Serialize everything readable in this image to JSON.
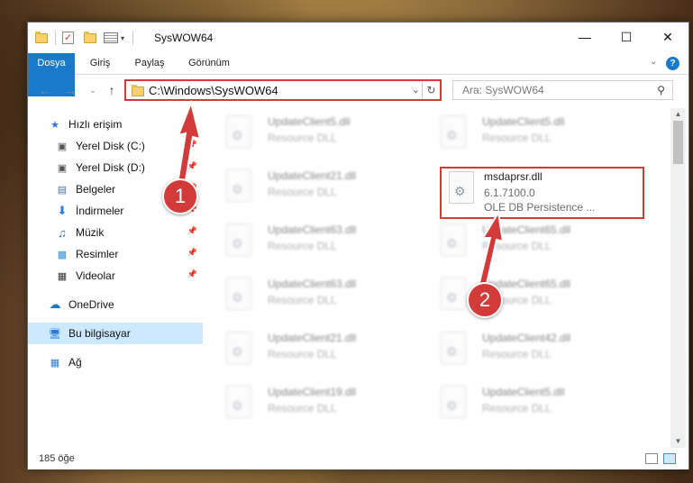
{
  "window": {
    "title": "SysWOW64",
    "minimize_icon": "minimize-icon",
    "maximize_icon": "maximize-icon",
    "close_icon": "close-icon"
  },
  "quick_access_toolbar": {
    "icons": [
      "folder-icon",
      "properties-check-icon",
      "new-folder-icon",
      "properties-icon",
      "customize-caret-icon"
    ]
  },
  "ribbon": {
    "tabs": [
      {
        "label": "Dosya",
        "active": true
      },
      {
        "label": "Giriş"
      },
      {
        "label": "Paylaş"
      },
      {
        "label": "Görünüm"
      }
    ],
    "help_label": "?"
  },
  "navigation": {
    "back_icon": "back-arrow-icon",
    "forward_icon": "forward-arrow-icon",
    "recent_icon": "chevron-down-icon",
    "up_icon": "up-arrow-icon",
    "address": "C:\\Windows\\SysWOW64",
    "search_placeholder": "Ara: SysWOW64"
  },
  "sidebar": {
    "items": [
      {
        "label": "Hızlı erişim",
        "icon": "star-icon"
      },
      {
        "label": "Yerel Disk (C:)",
        "icon": "drive-icon",
        "pinned": true
      },
      {
        "label": "Yerel Disk (D:)",
        "icon": "drive-icon",
        "pinned": true
      },
      {
        "label": "Belgeler",
        "icon": "documents-icon",
        "pinned": true
      },
      {
        "label": "İndirmeler",
        "icon": "download-icon",
        "pinned": true
      },
      {
        "label": "Müzik",
        "icon": "music-icon",
        "pinned": true
      },
      {
        "label": "Resimler",
        "icon": "pictures-icon",
        "pinned": true
      },
      {
        "label": "Videolar",
        "icon": "videos-icon",
        "pinned": true
      },
      {
        "label": "OneDrive",
        "icon": "cloud-icon"
      },
      {
        "label": "Bu bilgisayar",
        "icon": "computer-icon",
        "selected": true
      },
      {
        "label": "Ağ",
        "icon": "network-icon"
      }
    ]
  },
  "files": [
    {
      "name": "UpdateClient5.dll",
      "type": "Resource DLL"
    },
    {
      "name": "UpdateClient5.dll",
      "type": "Resource DLL"
    },
    {
      "name": "UpdateClient21.dll",
      "type": "Resource DLL"
    },
    {
      "name": "msdaprsr.dll",
      "version": "6.1.7100.0",
      "description": "OLE DB Persistence ...",
      "highlighted": true
    },
    {
      "name": "UpdateClient63.dll",
      "type": "Resource DLL"
    },
    {
      "name": "UpdateClient65.dll",
      "type": "Resource DLL"
    },
    {
      "name": "UpdateClient63.dll",
      "type": "Resource DLL"
    },
    {
      "name": "UpdateClient65.dll",
      "type": "Resource DLL"
    },
    {
      "name": "UpdateClient21.dll",
      "type": "Resource DLL"
    },
    {
      "name": "UpdateClient42.dll",
      "type": "Resource DLL"
    },
    {
      "name": "UpdateClient19.dll",
      "type": "Resource DLL"
    },
    {
      "name": "UpdateClient5.dll",
      "type": "Resource DLL"
    }
  ],
  "status": {
    "item_count": "185 öğe"
  },
  "annotations": {
    "step1": "1",
    "step2": "2",
    "color": "#d33b3b"
  }
}
